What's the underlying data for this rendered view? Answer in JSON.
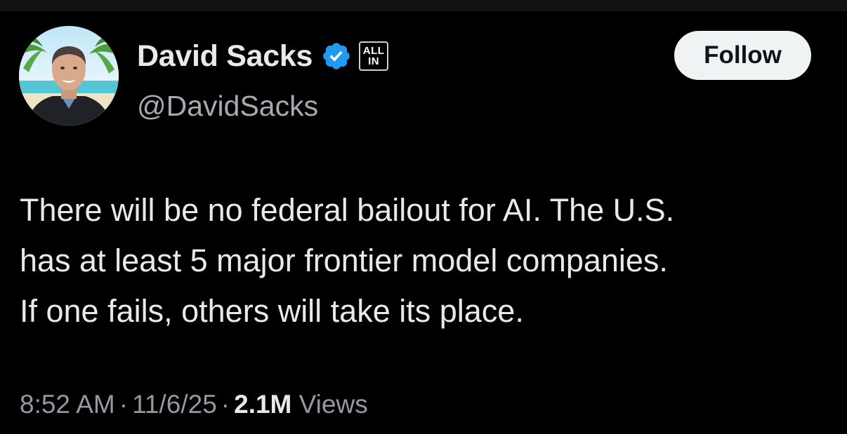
{
  "author": {
    "display_name": "David Sacks",
    "handle": "@DavidSacks",
    "verified_icon": "verified-badge-icon",
    "verified_color": "#1d9bf0",
    "affiliation_badge": {
      "line1": "ALL",
      "line2": "IN"
    }
  },
  "actions": {
    "follow_label": "Follow"
  },
  "tweet": {
    "text_lines": [
      "There will be no federal bailout for AI. The U.S.",
      "has at least 5 major frontier model companies.",
      "If one fails, others will take its place."
    ],
    "time": "8:52 AM",
    "date": "11/6/25",
    "separator": "·",
    "views_count": "2.1M",
    "views_label": "Views"
  },
  "colors": {
    "background": "#000000",
    "primary_text": "#e7e9ea",
    "secondary_text": "#71767b",
    "button_bg": "#eff3f4",
    "button_text": "#0f1419"
  }
}
